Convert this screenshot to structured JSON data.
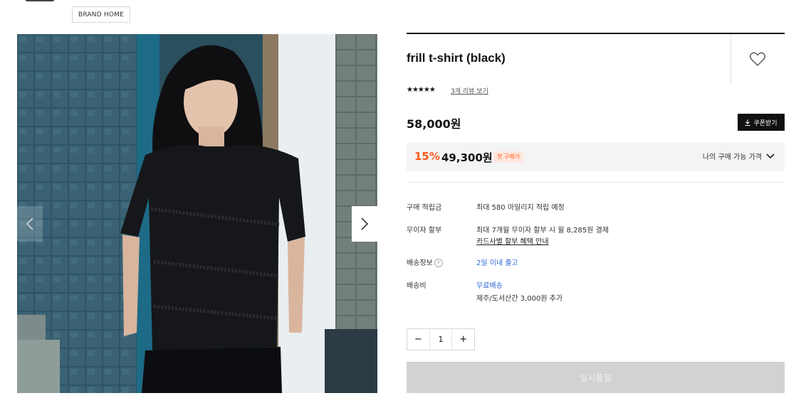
{
  "header": {
    "brand_home_label": "BRAND HOME"
  },
  "gallery": {
    "image_alt": "model wearing black frill t-shirt",
    "prev_icon": "chevron-left-icon",
    "next_icon": "chevron-right-icon"
  },
  "product": {
    "title": "frill t-shirt (black)",
    "rating_stars": "★★★★★",
    "review_link": "3개 리뷰 보기",
    "price": "58,000원",
    "coupon_label": "쿠폰받기",
    "coupon_icon": "download-icon",
    "wish_icon": "heart-icon"
  },
  "sale": {
    "rate": "15%",
    "price": "49,300원",
    "badge": "첫 구매가",
    "my_price_label": "나의 구매 가능 가격",
    "toggle_icon": "chevron-down-icon"
  },
  "info": [
    {
      "label": "구매 적립금",
      "value": "최대 580 마일리지 적립 예정"
    },
    {
      "label": "무이자 할부",
      "value": "최대 7개월 무이자 할부 시 월 8,285원 결제",
      "link": "카드사별 할부 혜택 안내"
    },
    {
      "label": "배송정보",
      "value": "2일 이내 출고"
    },
    {
      "label": "배송비",
      "value": "무료배송",
      "sub": "제주/도서산간 3,000원 추가"
    }
  ],
  "quantity": {
    "minus": "−",
    "value": "1",
    "plus": "+"
  },
  "buy_button": "일시품절",
  "colors": {
    "accent": "#ff5a1f",
    "link_blue": "#2f66d6",
    "dark": "#111111"
  }
}
